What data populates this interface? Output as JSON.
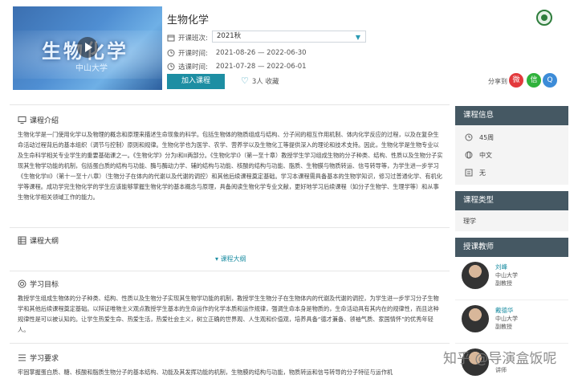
{
  "course": {
    "title": "生物化学",
    "cover_art_text": "生物化学",
    "cover_uni_text": "中山大学",
    "session_label": "开课班次:",
    "session_value": "2021秋",
    "open_time_label": "开课时间:",
    "open_time_value": "2021-08-26 — 2022-06-30",
    "select_time_label": "选课时间:",
    "select_time_value": "2021-07-28 — 2022-06-01",
    "join_label": "加入课程",
    "favorites_label": "3人 收藏",
    "share_label": "分享到"
  },
  "sections": {
    "intro_title": "课程介绍",
    "intro_text": "生物化学是一门使用化学以及物理的概念和原理来描述生命现象的科学。包括生物体的物质组成与结构、分子间的相互作用机制、体内化学反应的过程，以及在复杂生命活动过程背后的基本组织（调节与控制）原则和规律。生物化学也为医学、农学、营养学以及生物化工等提供深入的理论和技术支持。因此，生物化学是生物专业以及生命科学相关专业学生的重要基础课之一。《生物化学》分为I和II两部分。《生物化学I》（第一至十章）教授学生学习组成生物的分子种类、结构、性质以及生物分子实现其生物学功能的机制，包括蛋白质的结构与功能、酶与酶动力学、辅的结构与功能、核酸的结构与功能、脂质、生物膜与物质转运、信号转导等，为学生进一步学习《生物化学II》（第十一至十八章）（生物分子在体内的代谢以及代谢的调控）和其他后续课程奠定基础。学习本课程需具备基本的生物学知识，修习过普通化学、有机化学等课程。成功学完生物化学的学生应该能够掌握生物化学的基本概念与原理，具备阅读生物化学专业文献，更好地学习后续课程（如分子生物学、生理学等）和从事生物化学相关领域工作的能力。",
    "outline_title": "课程大纲",
    "outline_link": "课程大纲",
    "goals_title": "学习目标",
    "goals_text": "教授学生组成生物体的分子种类、结构、性质以及生物分子实现其生物学功能的机制，教授学生生物分子在生物体内的代谢及代谢的调控，为学生进一步学习分子生物学和其他后续课程奠定基础。以辩证唯物主义观点教授学生基本的生命运作的化学本质和运作规律，强调生命本身是物质的，生命活动具有其内在的规律性，而且这种规律性是可以被认知的。让学生热爱生命、热爱生活，热爱社会主义，树立正确的世界观、人生观和价值观，培养具备“德才兼备、领袖气质、家国情怀”的优秀年轻人。",
    "reqs_title": "学习要求",
    "reqs_text": "牢固掌握蛋白质、糖、核酸和脂质生物分子的基本结构、功能及其发挥功能的机制，生物膜的结构与功能，物质转运和信号转导的分子特征与运作机"
  },
  "sidebar": {
    "info_title": "课程信息",
    "weeks": "45周",
    "language": "中文",
    "subtitle": "无",
    "type_title": "课程类型",
    "type_value": "理学",
    "teachers_title": "授课教师",
    "teachers": [
      {
        "name": "刘峰",
        "uni": "中山大学",
        "title": "副教授"
      },
      {
        "name": "戴德华",
        "uni": "中山大学",
        "title": "副教授"
      },
      {
        "name": "",
        "uni": "",
        "title": "讲师"
      }
    ]
  },
  "watermark": "知乎 @导演盒饭呢",
  "colors": {
    "accent": "#1d8ea3",
    "sidebar_header": "#455863"
  }
}
